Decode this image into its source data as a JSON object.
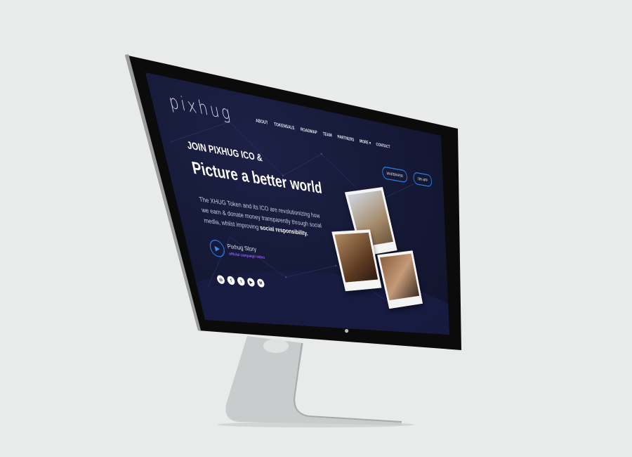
{
  "site": {
    "logo": "pixhug",
    "nav": [
      "ABOUT",
      "TOKENSALE",
      "ROADMAP",
      "TEAM",
      "PARTNERS",
      "MORE ▾",
      "CONTACT"
    ],
    "whitepaper_button": "WHITEPAPER",
    "join_button": "TRY APP",
    "kicker": "JOIN PIXHUG ICO &",
    "headline": "Picture a better world",
    "description": "The XHUG Token and its ICO are revolutionizing how we earn & donate money transparently through social media, whilst improving",
    "description_bold": "social responsibility.",
    "story_title": "Pixhug Story",
    "story_subtitle": "official campaign video",
    "social_icons": [
      "instagram-icon",
      "facebook-icon",
      "twitter-icon",
      "youtube-icon",
      "medium-icon"
    ],
    "social_glyphs": [
      "◎",
      "f",
      "t",
      "▶",
      "M"
    ]
  },
  "colors": {
    "accent": "#2c7be5",
    "background": "#141833",
    "purple": "#8a5cf6"
  }
}
